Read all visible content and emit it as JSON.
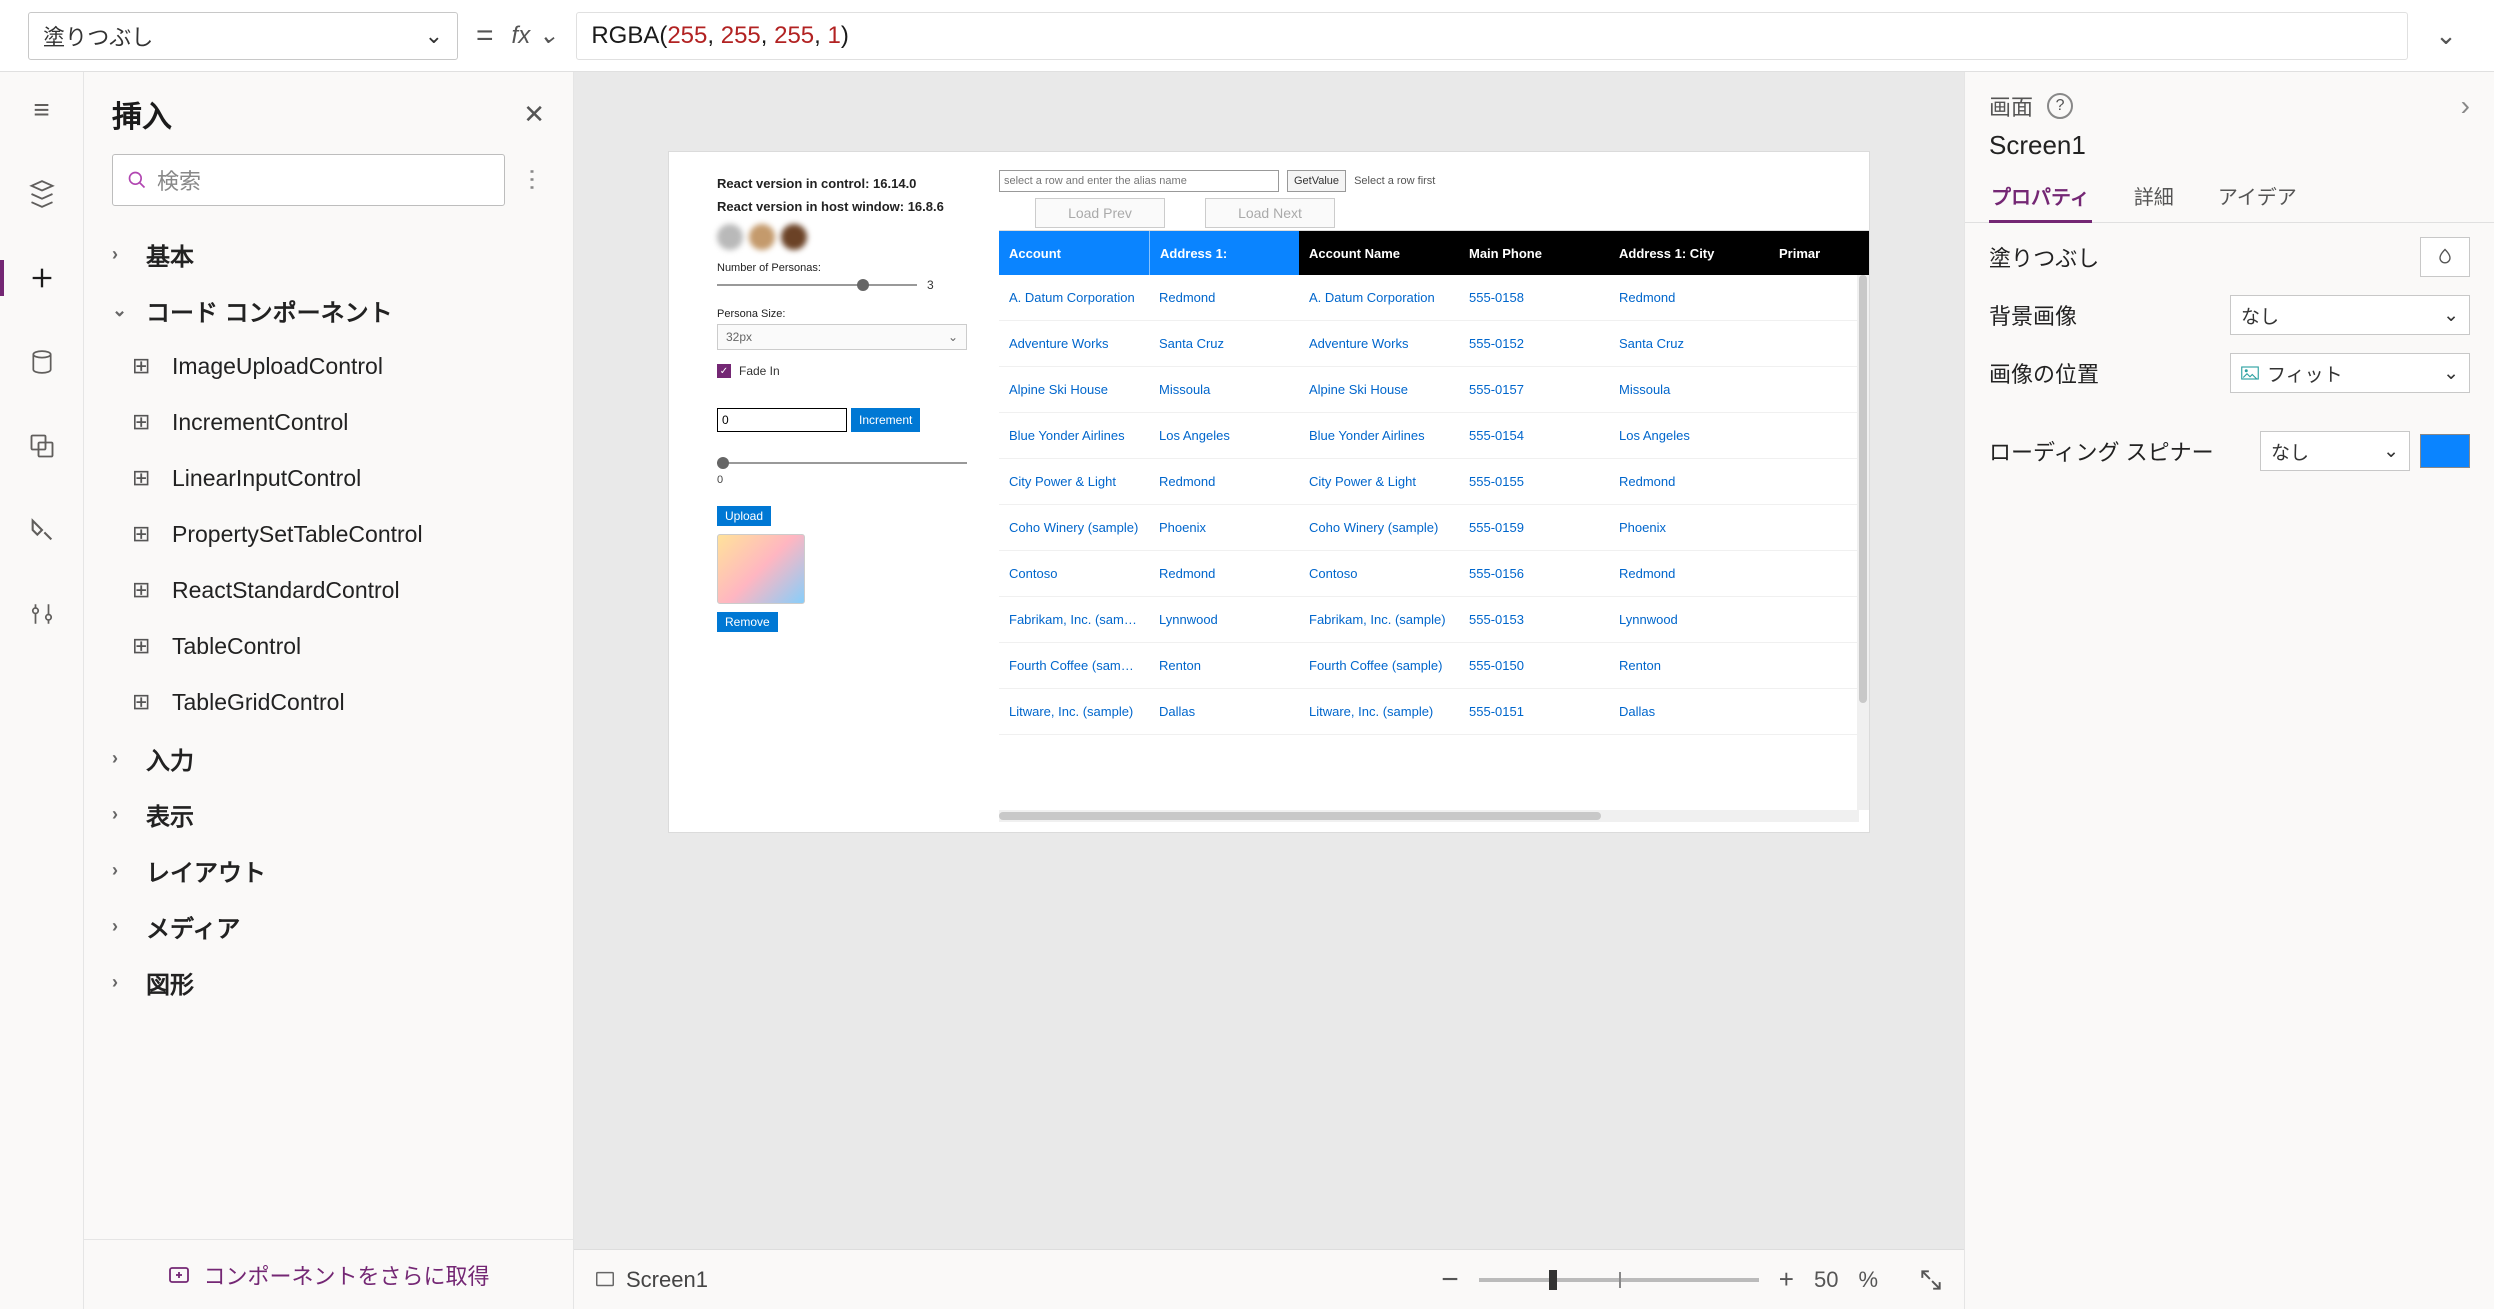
{
  "formula_bar": {
    "property_label": "塗りつぶし",
    "fx_label": "fx",
    "formula_fn": "RGBA",
    "formula_args": "(255, 255, 255, 1)"
  },
  "insert_pane": {
    "title": "挿入",
    "search_placeholder": "検索",
    "sections": {
      "basic": "基本",
      "code_components": "コード コンポーネント",
      "input": "入力",
      "display": "表示",
      "layout": "レイアウト",
      "media": "メディア",
      "shapes": "図形"
    },
    "components": [
      "ImageUploadControl",
      "IncrementControl",
      "LinearInputControl",
      "PropertySetTableControl",
      "ReactStandardControl",
      "TableControl",
      "TableGridControl"
    ],
    "footer": "コンポーネントをさらに取得"
  },
  "canvas": {
    "react_in_control": "React version in control: 16.14.0",
    "react_in_host": "React version in host window: 16.8.6",
    "num_personas_label": "Number of Personas:",
    "num_personas_value": "3",
    "persona_size_label": "Persona Size:",
    "persona_size_value": "32px",
    "fade_in_label": "Fade In",
    "increment_value": "0",
    "increment_btn": "Increment",
    "slider2_value": "0",
    "upload_btn": "Upload",
    "remove_btn": "Remove",
    "alias_placeholder": "select a row and enter the alias name",
    "getvalue_btn": "GetValue",
    "select_hint": "Select a row first",
    "load_prev": "Load Prev",
    "load_next": "Load Next",
    "columns": [
      "Account",
      "Address 1:",
      "Account Name",
      "Main Phone",
      "Address 1: City",
      "Primar"
    ],
    "rows": [
      [
        "A. Datum Corporation",
        "Redmond",
        "A. Datum Corporation",
        "555-0158",
        "Redmond"
      ],
      [
        "Adventure Works",
        "Santa Cruz",
        "Adventure Works",
        "555-0152",
        "Santa Cruz"
      ],
      [
        "Alpine Ski House",
        "Missoula",
        "Alpine Ski House",
        "555-0157",
        "Missoula"
      ],
      [
        "Blue Yonder Airlines",
        "Los Angeles",
        "Blue Yonder Airlines",
        "555-0154",
        "Los Angeles"
      ],
      [
        "City Power & Light",
        "Redmond",
        "City Power & Light",
        "555-0155",
        "Redmond"
      ],
      [
        "Coho Winery (sample)",
        "Phoenix",
        "Coho Winery (sample)",
        "555-0159",
        "Phoenix"
      ],
      [
        "Contoso",
        "Redmond",
        "Contoso",
        "555-0156",
        "Redmond"
      ],
      [
        "Fabrikam, Inc. (sample)",
        "Lynnwood",
        "Fabrikam, Inc. (sample)",
        "555-0153",
        "Lynnwood"
      ],
      [
        "Fourth Coffee (sample)",
        "Renton",
        "Fourth Coffee (sample)",
        "555-0150",
        "Renton"
      ],
      [
        "Litware, Inc. (sample)",
        "Dallas",
        "Litware, Inc. (sample)",
        "555-0151",
        "Dallas"
      ]
    ]
  },
  "status_bar": {
    "screen_name": "Screen1",
    "zoom_value": "50",
    "zoom_pct": "%"
  },
  "props_pane": {
    "context_label": "画面",
    "screen_name": "Screen1",
    "tabs": {
      "properties": "プロパティ",
      "advanced": "詳細",
      "ideas": "アイデア"
    },
    "rows": {
      "fill": "塗りつぶし",
      "bg_image": "背景画像",
      "bg_image_value": "なし",
      "image_position": "画像の位置",
      "image_position_value": "フィット",
      "loading_spinner": "ローディング スピナー",
      "loading_spinner_value": "なし"
    }
  }
}
